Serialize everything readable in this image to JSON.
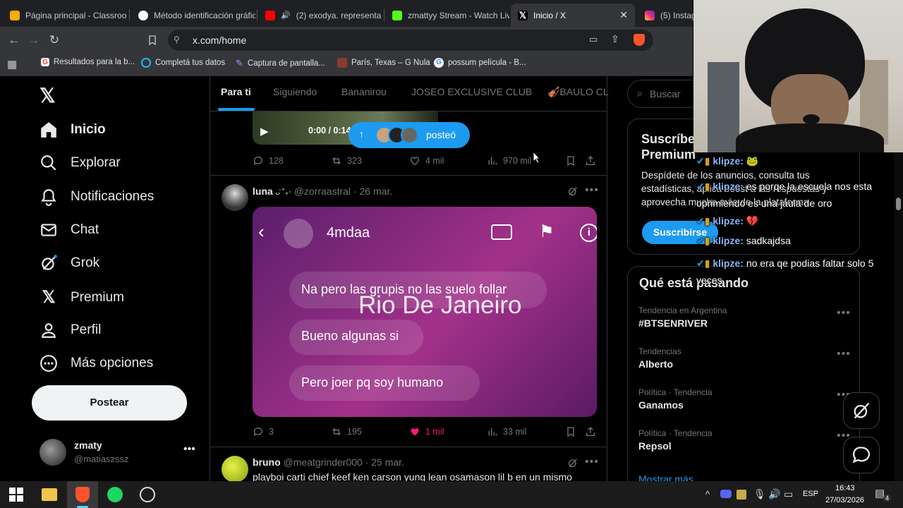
{
  "browser": {
    "tabs": [
      {
        "title": "Página principal - Classroom",
        "color": "#f9ab00"
      },
      {
        "title": "Método identificación gráfica",
        "color": "#ffffff"
      },
      {
        "title": "(2) exodya. representa",
        "color": "#ff0000"
      },
      {
        "title": "zmattyy Stream - Watch Live",
        "color": "#53fc18"
      },
      {
        "title": "Inicio / X",
        "color": "#000000"
      },
      {
        "title": "(5) Instagram",
        "color": "#e1306c"
      }
    ],
    "url": "x.com/home",
    "bookmarks": [
      "Resultados para la b...",
      "Completá tus datos",
      "Captura de pantalla...",
      "París, Texas – G Nula",
      "possum película - B..."
    ]
  },
  "nav": {
    "items": [
      "Inicio",
      "Explorar",
      "Notificaciones",
      "Chat",
      "Grok",
      "Premium",
      "Perfil",
      "Más opciones"
    ],
    "post_label": "Postear",
    "user_name": "zmaty",
    "user_handle": "@matiaszssz"
  },
  "timeline": {
    "tabs": [
      "Para ti",
      "Siguiendo",
      "Bananirou",
      "JOSEO EXCLUSIVE CLUB",
      "🎻BAULO CL"
    ],
    "posted_pill": "posteó",
    "video_time": "0:00 / 0:14",
    "post1_stats": {
      "replies": "128",
      "reposts": "323",
      "likes": "4 mil",
      "views": "970 mil"
    },
    "post2": {
      "author": "luna",
      "author_suffix": "ᴗ̈ ˚₊‧",
      "handle": "@zorraastral",
      "date": "· 26 mar.",
      "dm_name": "4mdaa",
      "messages": [
        "Na pero las grupis no las suelo follar",
        "Bueno algunas si",
        "Pero joer pq soy humano"
      ],
      "overlay_text": "Rio De Janeiro",
      "replies": "3",
      "reposts": "195",
      "likes": "1 mil",
      "views": "33 mil"
    },
    "post3": {
      "author": "bruno",
      "handle": "@meatgrinder000",
      "date": "· 25 mar.",
      "text": "playboi carti chief keef ken carson yung lean osamason lil b en un mismo"
    }
  },
  "right": {
    "search_placeholder": "Buscar",
    "premium_title_1": "Suscríbe",
    "premium_title_2": "Premium",
    "premium_text": "Despídete de los anuncios, consulta tus estadísticas, aplica boost a las respuestas y aprovecha mucho más de la plataforma",
    "premium_button": "Suscribirse",
    "trending_title": "Qué está pasando",
    "trends": [
      {
        "context": "Tendencia en Argentina",
        "name": "#BTSENRIVER"
      },
      {
        "context": "Tendencias",
        "name": "Alberto"
      },
      {
        "context": "Política · Tendencia",
        "name": "Ganamos"
      },
      {
        "context": "Política · Tendencia",
        "name": "Repsol"
      }
    ],
    "show_more": "Mostrar más"
  },
  "chat": [
    {
      "user": "klipze",
      "msg": "🐸"
    },
    {
      "user": "klipze",
      "msg": "es porqe la escuela nos esta oprimiendo es una jaula de oro"
    },
    {
      "user": "klipze",
      "msg": "💔"
    },
    {
      "user": "klipze",
      "msg": "sadkajdsa"
    },
    {
      "user": "klipze",
      "msg": "no era qe podias faltar solo 5 veces"
    }
  ],
  "taskbar": {
    "lang": "ESP",
    "time": "16:43",
    "date": "27/03/2026",
    "notif_count": "4"
  }
}
